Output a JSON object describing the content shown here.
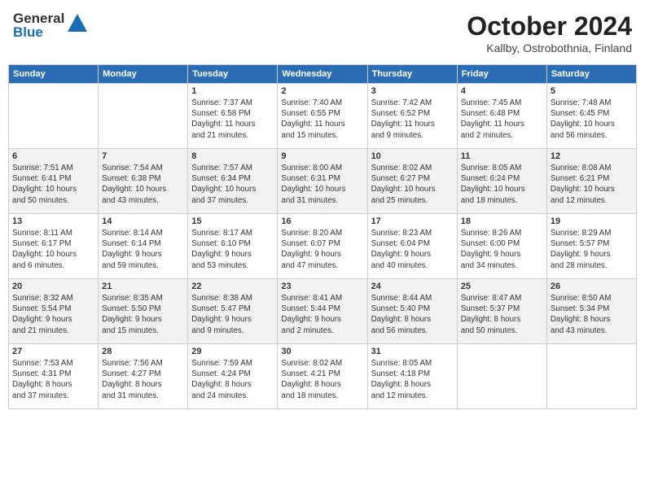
{
  "header": {
    "logo_general": "General",
    "logo_blue": "Blue",
    "title": "October 2024",
    "subtitle": "Kallby, Ostrobothnia, Finland"
  },
  "weekdays": [
    "Sunday",
    "Monday",
    "Tuesday",
    "Wednesday",
    "Thursday",
    "Friday",
    "Saturday"
  ],
  "weeks": [
    [
      {
        "day": "",
        "info": ""
      },
      {
        "day": "",
        "info": ""
      },
      {
        "day": "1",
        "info": "Sunrise: 7:37 AM\nSunset: 6:58 PM\nDaylight: 11 hours\nand 21 minutes."
      },
      {
        "day": "2",
        "info": "Sunrise: 7:40 AM\nSunset: 6:55 PM\nDaylight: 11 hours\nand 15 minutes."
      },
      {
        "day": "3",
        "info": "Sunrise: 7:42 AM\nSunset: 6:52 PM\nDaylight: 11 hours\nand 9 minutes."
      },
      {
        "day": "4",
        "info": "Sunrise: 7:45 AM\nSunset: 6:48 PM\nDaylight: 11 hours\nand 2 minutes."
      },
      {
        "day": "5",
        "info": "Sunrise: 7:48 AM\nSunset: 6:45 PM\nDaylight: 10 hours\nand 56 minutes."
      }
    ],
    [
      {
        "day": "6",
        "info": "Sunrise: 7:51 AM\nSunset: 6:41 PM\nDaylight: 10 hours\nand 50 minutes."
      },
      {
        "day": "7",
        "info": "Sunrise: 7:54 AM\nSunset: 6:38 PM\nDaylight: 10 hours\nand 43 minutes."
      },
      {
        "day": "8",
        "info": "Sunrise: 7:57 AM\nSunset: 6:34 PM\nDaylight: 10 hours\nand 37 minutes."
      },
      {
        "day": "9",
        "info": "Sunrise: 8:00 AM\nSunset: 6:31 PM\nDaylight: 10 hours\nand 31 minutes."
      },
      {
        "day": "10",
        "info": "Sunrise: 8:02 AM\nSunset: 6:27 PM\nDaylight: 10 hours\nand 25 minutes."
      },
      {
        "day": "11",
        "info": "Sunrise: 8:05 AM\nSunset: 6:24 PM\nDaylight: 10 hours\nand 18 minutes."
      },
      {
        "day": "12",
        "info": "Sunrise: 8:08 AM\nSunset: 6:21 PM\nDaylight: 10 hours\nand 12 minutes."
      }
    ],
    [
      {
        "day": "13",
        "info": "Sunrise: 8:11 AM\nSunset: 6:17 PM\nDaylight: 10 hours\nand 6 minutes."
      },
      {
        "day": "14",
        "info": "Sunrise: 8:14 AM\nSunset: 6:14 PM\nDaylight: 9 hours\nand 59 minutes."
      },
      {
        "day": "15",
        "info": "Sunrise: 8:17 AM\nSunset: 6:10 PM\nDaylight: 9 hours\nand 53 minutes."
      },
      {
        "day": "16",
        "info": "Sunrise: 8:20 AM\nSunset: 6:07 PM\nDaylight: 9 hours\nand 47 minutes."
      },
      {
        "day": "17",
        "info": "Sunrise: 8:23 AM\nSunset: 6:04 PM\nDaylight: 9 hours\nand 40 minutes."
      },
      {
        "day": "18",
        "info": "Sunrise: 8:26 AM\nSunset: 6:00 PM\nDaylight: 9 hours\nand 34 minutes."
      },
      {
        "day": "19",
        "info": "Sunrise: 8:29 AM\nSunset: 5:57 PM\nDaylight: 9 hours\nand 28 minutes."
      }
    ],
    [
      {
        "day": "20",
        "info": "Sunrise: 8:32 AM\nSunset: 5:54 PM\nDaylight: 9 hours\nand 21 minutes."
      },
      {
        "day": "21",
        "info": "Sunrise: 8:35 AM\nSunset: 5:50 PM\nDaylight: 9 hours\nand 15 minutes."
      },
      {
        "day": "22",
        "info": "Sunrise: 8:38 AM\nSunset: 5:47 PM\nDaylight: 9 hours\nand 9 minutes."
      },
      {
        "day": "23",
        "info": "Sunrise: 8:41 AM\nSunset: 5:44 PM\nDaylight: 9 hours\nand 2 minutes."
      },
      {
        "day": "24",
        "info": "Sunrise: 8:44 AM\nSunset: 5:40 PM\nDaylight: 8 hours\nand 56 minutes."
      },
      {
        "day": "25",
        "info": "Sunrise: 8:47 AM\nSunset: 5:37 PM\nDaylight: 8 hours\nand 50 minutes."
      },
      {
        "day": "26",
        "info": "Sunrise: 8:50 AM\nSunset: 5:34 PM\nDaylight: 8 hours\nand 43 minutes."
      }
    ],
    [
      {
        "day": "27",
        "info": "Sunrise: 7:53 AM\nSunset: 4:31 PM\nDaylight: 8 hours\nand 37 minutes."
      },
      {
        "day": "28",
        "info": "Sunrise: 7:56 AM\nSunset: 4:27 PM\nDaylight: 8 hours\nand 31 minutes."
      },
      {
        "day": "29",
        "info": "Sunrise: 7:59 AM\nSunset: 4:24 PM\nDaylight: 8 hours\nand 24 minutes."
      },
      {
        "day": "30",
        "info": "Sunrise: 8:02 AM\nSunset: 4:21 PM\nDaylight: 8 hours\nand 18 minutes."
      },
      {
        "day": "31",
        "info": "Sunrise: 8:05 AM\nSunset: 4:18 PM\nDaylight: 8 hours\nand 12 minutes."
      },
      {
        "day": "",
        "info": ""
      },
      {
        "day": "",
        "info": ""
      }
    ]
  ]
}
